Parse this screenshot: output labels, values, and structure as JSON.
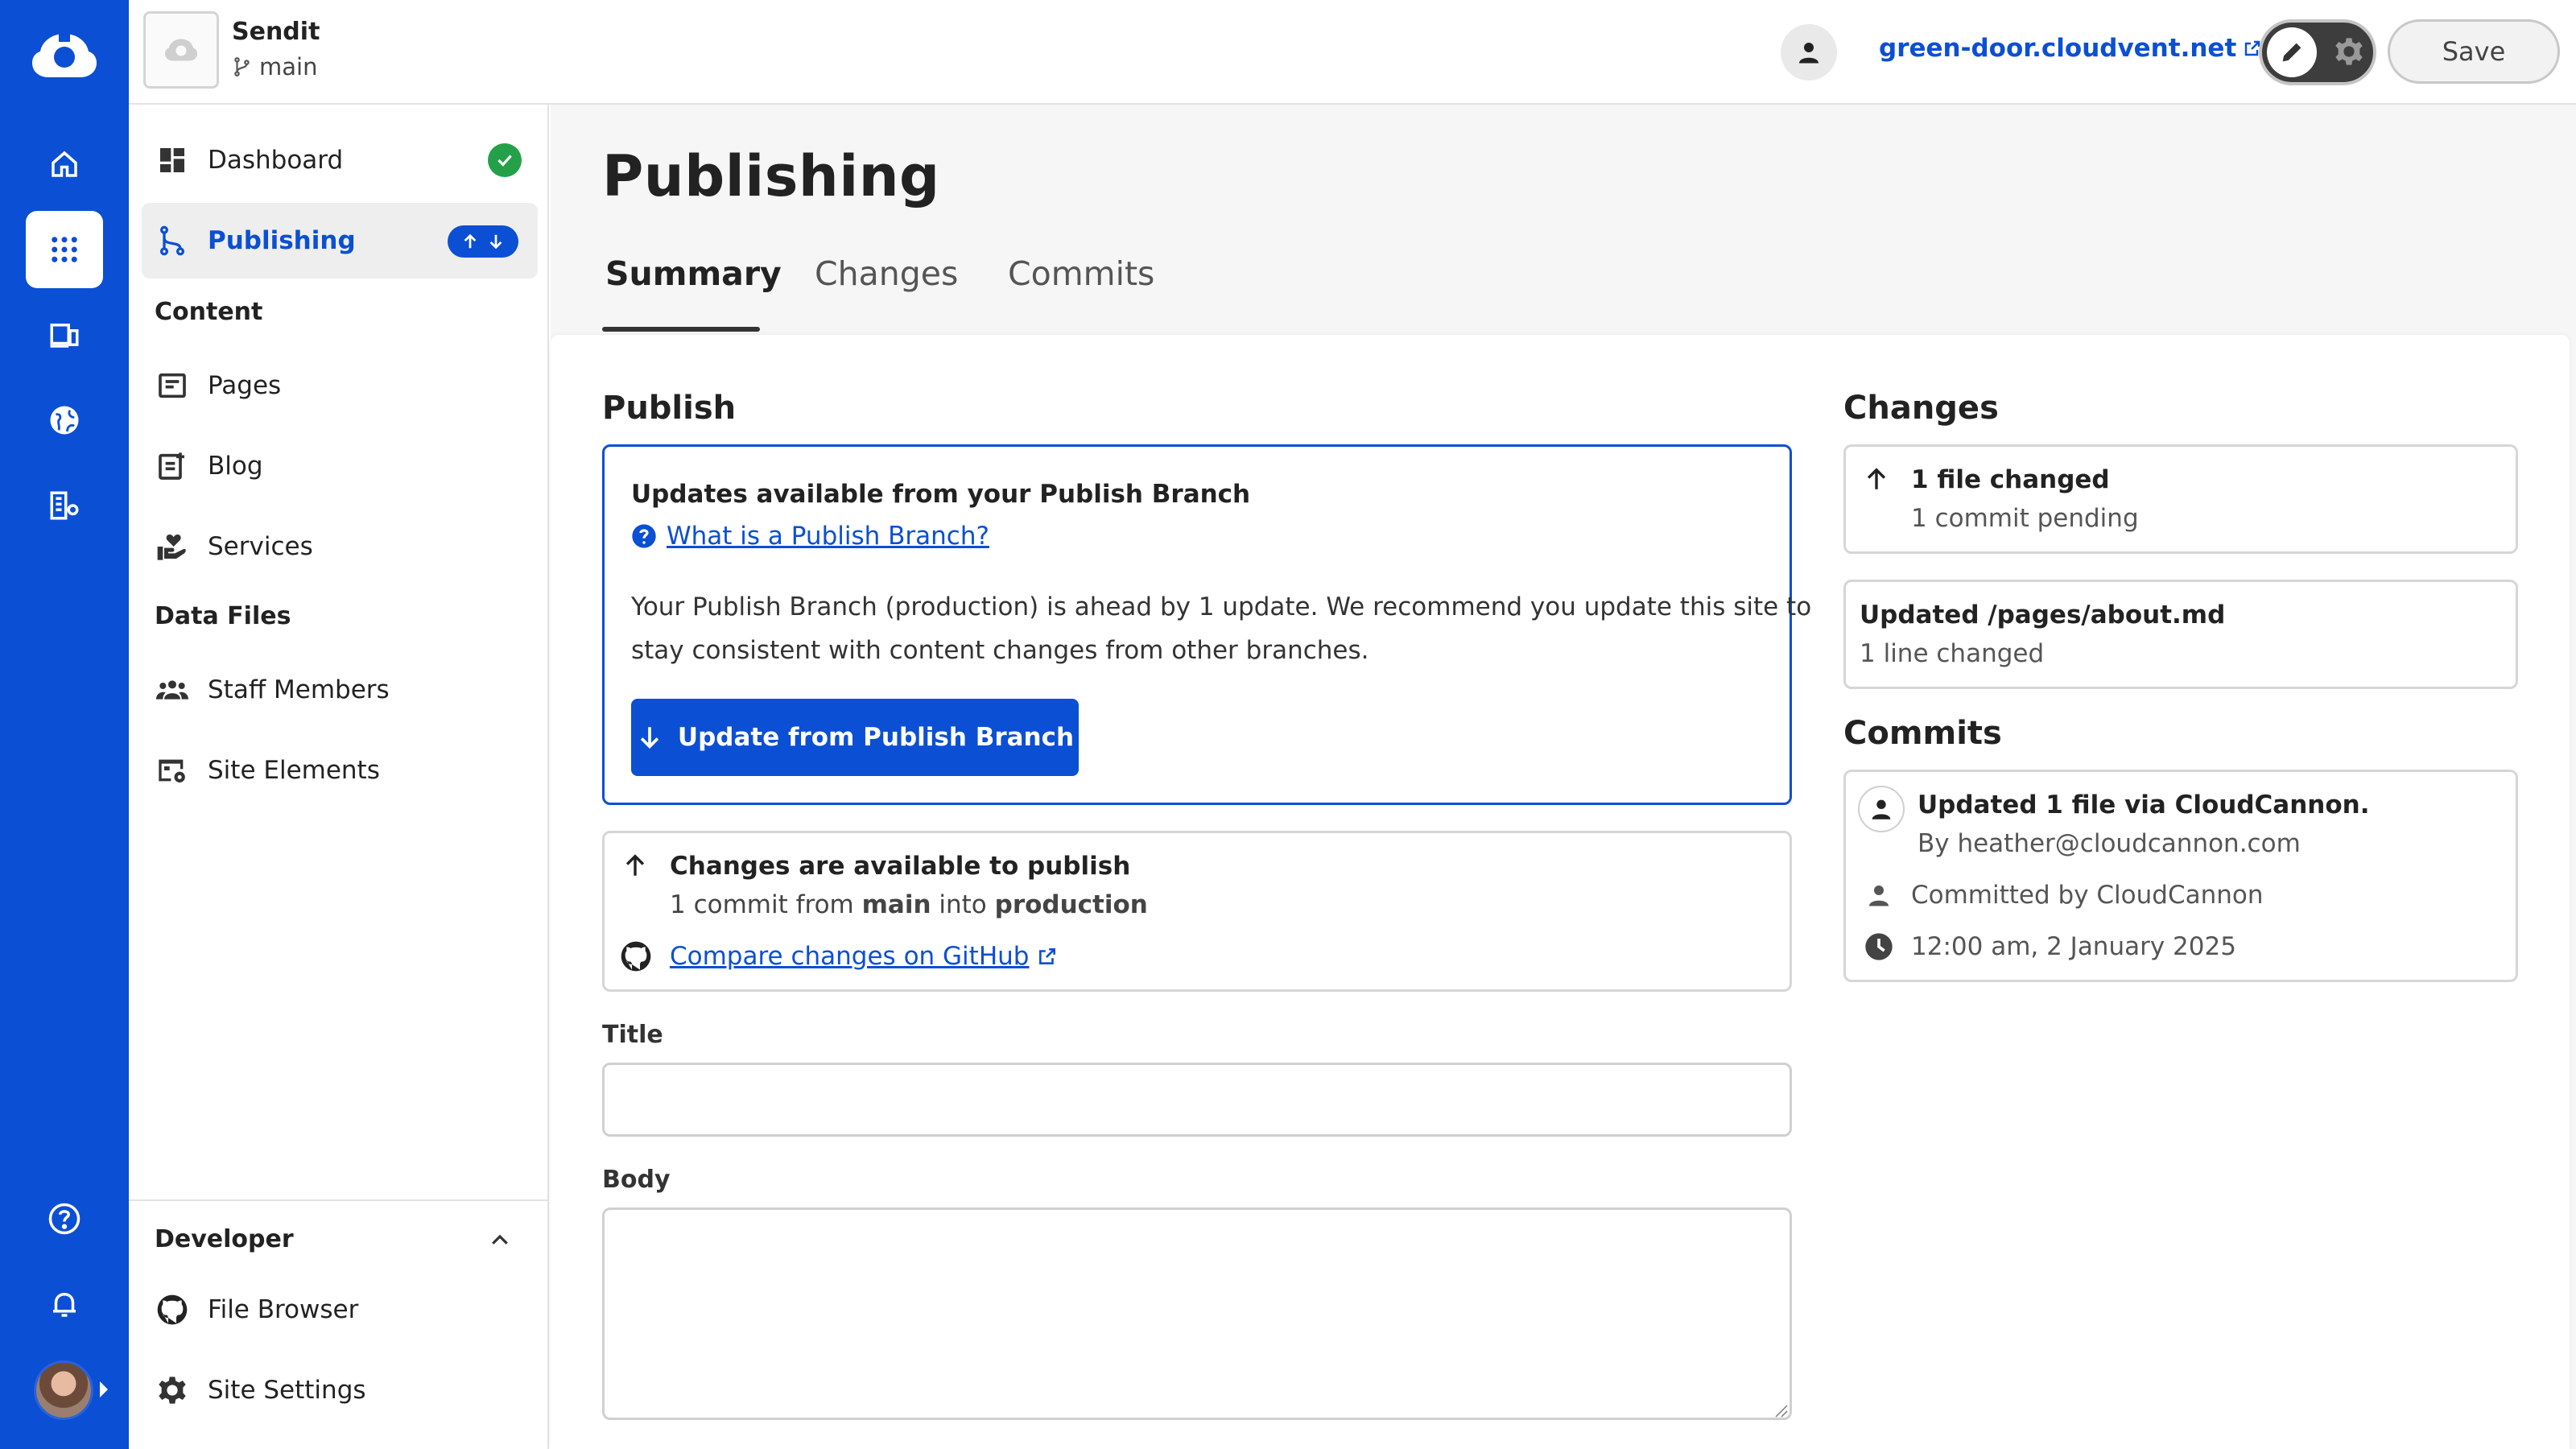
{
  "app": {
    "brand_color": "#0b4fd4"
  },
  "rail": {
    "icons": [
      "home-icon",
      "apps-grid-icon",
      "devices-icon",
      "globe-icon",
      "building-settings-icon",
      "help-icon",
      "bell-icon"
    ]
  },
  "topbar": {
    "site_name": "Sendit",
    "branch": "main",
    "site_url": "green-door.cloudvent.net",
    "save_label": "Save"
  },
  "sidebar": {
    "dashboard": "Dashboard",
    "publishing": "Publishing",
    "content_heading": "Content",
    "pages": "Pages",
    "blog": "Blog",
    "services": "Services",
    "data_files_heading": "Data Files",
    "staff_members": "Staff Members",
    "site_elements": "Site Elements",
    "developer_heading": "Developer",
    "file_browser": "File Browser",
    "site_settings": "Site Settings"
  },
  "main": {
    "title": "Publishing",
    "tabs": [
      {
        "label": "Summary"
      },
      {
        "label": "Changes"
      },
      {
        "label": "Commits"
      }
    ],
    "publish": {
      "heading": "Publish",
      "notice_title": "Updates available from your Publish Branch",
      "help_link": "What is a Publish Branch?",
      "notice_line1": "Your Publish Branch (production) is ahead by 1 update. We recommend you update this site to",
      "notice_line2": "stay consistent with content changes from other branches.",
      "update_button": "Update from Publish Branch",
      "changes_title": "Changes are available to publish",
      "commit_prefix": "1 commit from",
      "from_branch": "main",
      "into_word": "into",
      "to_branch": "production",
      "github_link": "Compare changes on GitHub",
      "title_label": "Title",
      "title_value": "",
      "body_label": "Body",
      "body_value": ""
    },
    "changes": {
      "heading": "Changes",
      "files_changed": "1 file changed",
      "commits_pending": "1 commit pending",
      "file_title": "Updated /pages/about.md",
      "file_detail": "1 line changed"
    },
    "commits": {
      "heading": "Commits",
      "message": "Updated 1 file via CloudCannon.",
      "author": "By heather@cloudcannon.com",
      "committer": "Committed by CloudCannon",
      "timestamp": "12:00 am, 2 January 2025"
    }
  }
}
